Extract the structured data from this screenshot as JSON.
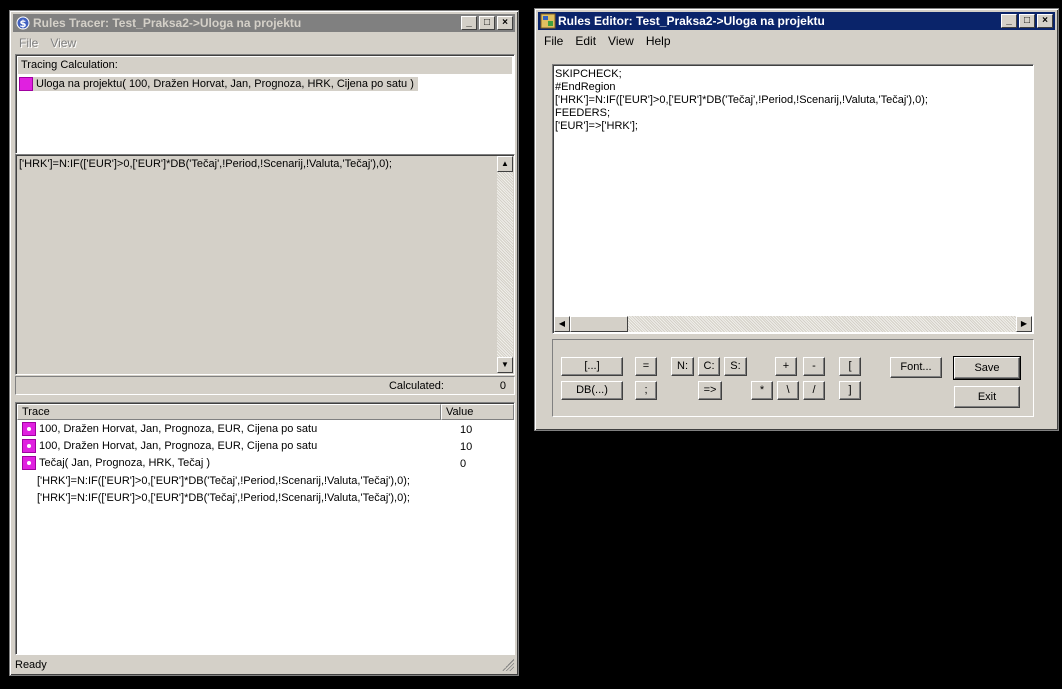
{
  "tracer": {
    "title": "Rules Tracer: Test_Praksa2->Uloga na projektu",
    "menu": [
      "File",
      "View"
    ],
    "tracing_label": "Tracing Calculation:",
    "tracing_item": "Uloga na projektu( 100, Dražen Horvat, Jan, Prognoza, HRK, Cijena po satu )",
    "rule_text": "['HRK']=N:IF(['EUR']>0,['EUR']*DB('Tečaj',!Period,!Scenarij,!Valuta,'Tečaj'),0);",
    "calculated_label": "Calculated:",
    "calculated_value": "0",
    "trace_header": "Trace",
    "value_header": "Value",
    "trace_rows": [
      {
        "text": "100, Dražen Horvat, Jan, Prognoza, EUR, Cijena po satu",
        "value": "10"
      },
      {
        "text": "100, Dražen Horvat, Jan, Prognoza, EUR, Cijena po satu",
        "value": "10"
      },
      {
        "text": "Tečaj( Jan, Prognoza, HRK, Tečaj )",
        "value": "0"
      },
      {
        "text": "['HRK']=N:IF(['EUR']>0,['EUR']*DB('Tečaj',!Period,!Scenarij,!Valuta,'Tečaj'),0);",
        "value": ""
      },
      {
        "text": "['HRK']=N:IF(['EUR']>0,['EUR']*DB('Tečaj',!Period,!Scenarij,!Valuta,'Tečaj'),0);",
        "value": ""
      }
    ],
    "status": "Ready"
  },
  "editor": {
    "title": "Rules Editor:  Test_Praksa2->Uloga na projektu",
    "menu": [
      "File",
      "Edit",
      "View",
      "Help"
    ],
    "code_lines": [
      "SKIPCHECK;",
      "#EndRegion",
      "['HRK']=N:IF(['EUR']>0,['EUR']*DB('Tečaj',!Period,!Scenarij,!Valuta,'Tečaj'),0);",
      "FEEDERS;",
      "['EUR']=>['HRK'];"
    ],
    "buttons": {
      "brackets": "[...]",
      "db": "DB(...)",
      "eq": "=",
      "semi": ";",
      "n": "N:",
      "c": "C:",
      "s": "S:",
      "feed": "=>",
      "plus": "+",
      "minus": "-",
      "lbr": "[",
      "rbr": "]",
      "mul": "*",
      "bslash": "\\",
      "div": "/",
      "font": "Font...",
      "save": "Save",
      "exit": "Exit"
    }
  },
  "title_buttons": {
    "min": "_",
    "max": "□",
    "close": "×"
  }
}
